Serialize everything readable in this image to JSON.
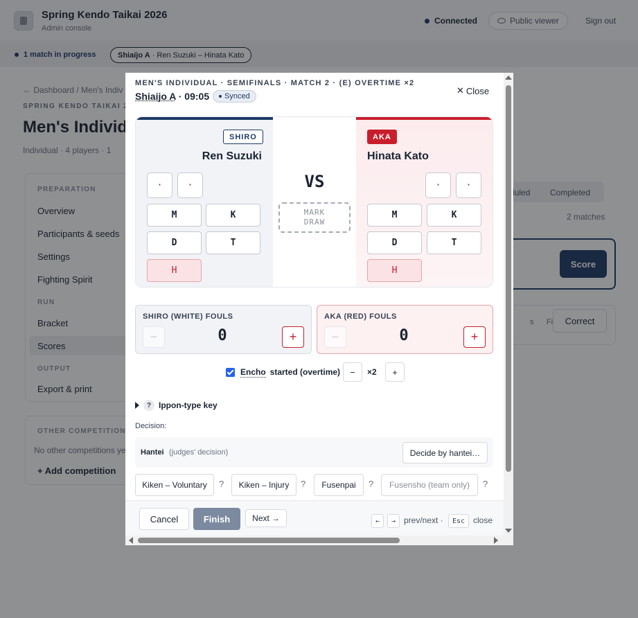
{
  "app": {
    "title": "Spring Kendo Taikai 2026",
    "subtitle": "Admin console",
    "connection": "Connected",
    "public_viewer": "Public viewer",
    "sign_out": "Sign out"
  },
  "status_bar": {
    "in_progress": "1 match in progress",
    "chip_court": "Shiaijo A",
    "chip_match": "· Ren Suzuki – Hinata Kato"
  },
  "page": {
    "breadcrumb": "← Dashboard / Men's Indiv",
    "eyebrow": "SPRING KENDO TAIKAI 2",
    "title": "Men's Individu",
    "meta": "Individual · 4 players · 1"
  },
  "sidebar": {
    "section_preparation": "PREPARATION",
    "overview": "Overview",
    "participants": "Participants & seeds",
    "settings": "Settings",
    "fighting_spirit": "Fighting Spirit",
    "section_run": "RUN",
    "bracket": "Bracket",
    "scores": "Scores",
    "section_output": "OUTPUT",
    "export": "Export & print"
  },
  "other_competitions": {
    "heading": "OTHER COMPETITION",
    "empty": "No other competitions ye",
    "add": "+ Add competition"
  },
  "background_right": {
    "seg_scheduled": "duled",
    "seg_completed": "Completed",
    "matches_count": "2 matches",
    "score_btn": "Score",
    "final_text": "Final",
    "s_fragment": "s",
    "correct_btn": "Correct"
  },
  "modal": {
    "eyebrow": "MEN'S INDIVIDUAL · SEMIFINALS · MATCH 2  · (E) OVERTIME ×2",
    "court": "Shiaijo A",
    "time": " · 09:05",
    "synced": "Synced",
    "close": "Close",
    "close_icon": "✕",
    "vs": "VS",
    "mark_draw_1": "MARK",
    "mark_draw_2": "DRAW",
    "shiro": {
      "badge": "SHIRO",
      "name": "Ren Suzuki",
      "slot_1": "·",
      "slot_2": "·",
      "waza_m": "M",
      "waza_k": "K",
      "waza_d": "D",
      "waza_t": "T",
      "waza_h": "H"
    },
    "aka": {
      "badge": "AKA",
      "name": "Hinata Kato",
      "slot_1": "·",
      "slot_2": "·",
      "waza_m": "M",
      "waza_k": "K",
      "waza_d": "D",
      "waza_t": "T",
      "waza_h": "H"
    },
    "fouls": {
      "shiro_label": "SHIRO (WHITE) FOULS",
      "shiro_value": "0",
      "aka_label": "AKA (RED) FOULS",
      "aka_value": "0",
      "minus": "−",
      "plus": "+"
    },
    "encho": {
      "checked": true,
      "word": "Encho",
      "rest": "started (overtime)",
      "minus": "−",
      "value": "×2",
      "plus": "+"
    },
    "ippon_key": {
      "q": "?",
      "label": "Ippon-type key"
    },
    "decision_label": "Decision:",
    "hantei": {
      "name": "Hantei",
      "desc": "(judges' decision)",
      "button": "Decide by hantei…"
    },
    "decisions": {
      "kiken_voluntary": "Kiken – Voluntary",
      "kiken_injury": "Kiken – Injury",
      "fusenpai": "Fusenpai",
      "fusensho": "Fusensho (team only)",
      "q": "?"
    },
    "footer": {
      "cancel": "Cancel",
      "finish": "Finish",
      "next": "Next",
      "next_arrow": "→",
      "key_prev": "←",
      "key_next": "→",
      "prev_next": "prev/next ·",
      "key_esc": "Esc",
      "close": "close"
    }
  },
  "colors": {
    "navy": "#1e3a66",
    "aka_red": "#c81e2c",
    "finish_disabled": "#7c8aa0"
  }
}
